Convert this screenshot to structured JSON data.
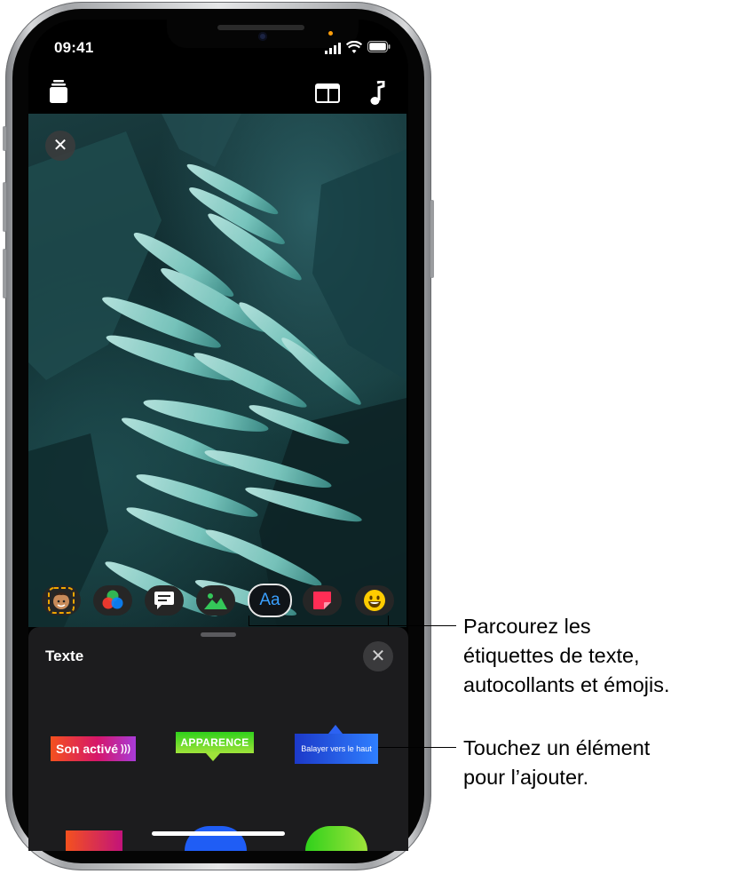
{
  "status_bar": {
    "time": "09:41"
  },
  "panel": {
    "title": "Texte",
    "stickers": [
      {
        "text": "Son activé"
      },
      {
        "text": "APPARENCE"
      },
      {
        "text": "Balayer vers le haut"
      }
    ]
  },
  "callouts": {
    "browse": [
      "Parcourez les",
      "étiquettes de texte,",
      "autocollants et émojis."
    ],
    "tap": [
      "Touchez un élément",
      "pour l’ajouter."
    ]
  },
  "effects_strip": {
    "selected_label": "Aa",
    "items": [
      "memoji-icon",
      "filters-icon",
      "speech-bubble-icon",
      "image-icon",
      "text-icon",
      "sticker-icon",
      "emoji-icon"
    ]
  },
  "colors": {
    "accent": "#3aa0ff",
    "panel": "#1c1c1e",
    "screen": "#000000"
  }
}
